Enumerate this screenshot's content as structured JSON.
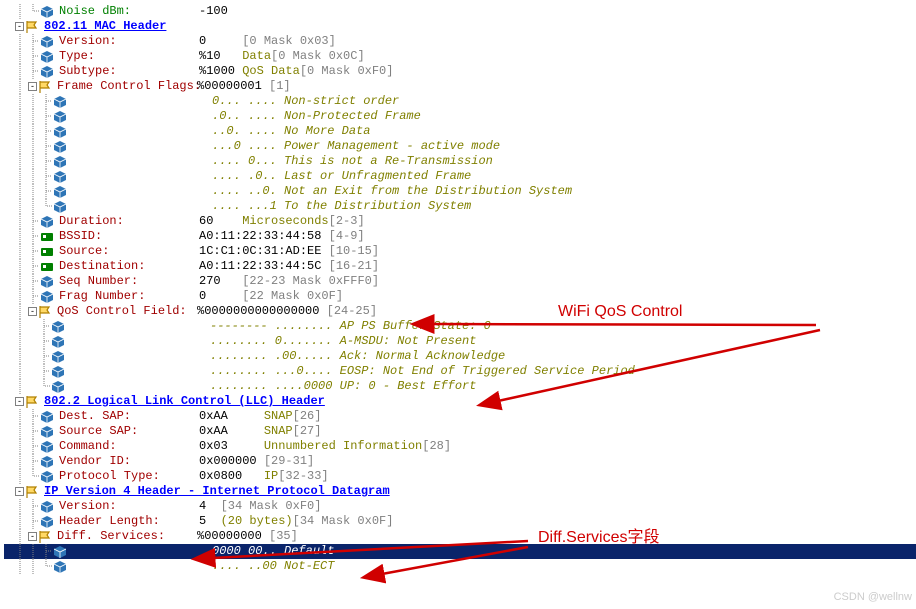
{
  "top_field": {
    "label": "Noise dBm:",
    "value": "-100"
  },
  "mac_header": {
    "title": "802.11 MAC Header",
    "fields": {
      "version": {
        "label": "Version:",
        "value": "0",
        "mask": "[0 Mask 0x03]"
      },
      "type": {
        "label": "Type:",
        "value": "%10",
        "desc": "Data",
        "mask": "[0 Mask 0x0C]"
      },
      "subtype": {
        "label": "Subtype:",
        "value": "%1000",
        "desc": "QoS Data",
        "mask": "[0 Mask 0xF0]"
      },
      "fcf": {
        "label": "Frame Control Flags:",
        "value": "%00000001",
        "mask": "[1]"
      },
      "fcf_bits": [
        {
          "bits": "0... ....",
          "desc": "Non-strict order"
        },
        {
          "bits": ".0.. ....",
          "desc": "Non-Protected Frame"
        },
        {
          "bits": "..0. ....",
          "desc": "No More Data"
        },
        {
          "bits": "...0 ....",
          "desc": "Power Management - active mode"
        },
        {
          "bits": ".... 0...",
          "desc": "This is not a Re-Transmission"
        },
        {
          "bits": ".... .0..",
          "desc": "Last or Unfragmented Frame"
        },
        {
          "bits": ".... ..0.",
          "desc": "Not an Exit from the Distribution System"
        },
        {
          "bits": ".... ...1",
          "desc": "To the Distribution System"
        }
      ],
      "duration": {
        "label": "Duration:",
        "value": "60",
        "desc": "Microseconds",
        "mask": "[2-3]"
      },
      "bssid": {
        "label": "BSSID:",
        "value": "A0:11:22:33:44:58",
        "mask": "[4-9]"
      },
      "source": {
        "label": "Source:",
        "value": "1C:C1:0C:31:AD:EE",
        "mask": "[10-15]"
      },
      "dest": {
        "label": "Destination:",
        "value": "A0:11:22:33:44:5C",
        "mask": "[16-21]"
      },
      "seq": {
        "label": "Seq Number:",
        "value": "270",
        "mask": "[22-23 Mask 0xFFF0]"
      },
      "frag": {
        "label": "Frag Number:",
        "value": "0",
        "mask": "[22 Mask 0x0F]"
      },
      "qos": {
        "label": "QoS Control Field:",
        "value": "%0000000000000000",
        "mask": "[24-25]"
      },
      "qos_bits": [
        {
          "bits": "-------- ........",
          "desc": "AP PS Buffer State: 0"
        },
        {
          "bits": "........ 0.......",
          "desc": "A-MSDU: Not Present"
        },
        {
          "bits": "........ .00.....",
          "desc": "Ack: Normal Acknowledge"
        },
        {
          "bits": "........ ...0....",
          "desc": "EOSP: Not End of Triggered Service Period"
        },
        {
          "bits": "........ ....0000",
          "desc": "UP: 0 - Best Effort"
        }
      ]
    }
  },
  "llc_header": {
    "title": "802.2 Logical Link Control (LLC) Header",
    "fields": {
      "dsap": {
        "label": "Dest. SAP:",
        "value": "0xAA",
        "desc": "SNAP",
        "mask": "[26]"
      },
      "ssap": {
        "label": "Source SAP:",
        "value": "0xAA",
        "desc": "SNAP",
        "mask": "[27]"
      },
      "cmd": {
        "label": "Command:",
        "value": "0x03",
        "desc": "Unnumbered Information",
        "mask": "[28]"
      },
      "vendor": {
        "label": "Vendor ID:",
        "value": "0x000000",
        "mask": "[29-31]"
      },
      "proto": {
        "label": "Protocol Type:",
        "value": "0x0800",
        "desc": "IP",
        "mask": "[32-33]"
      }
    }
  },
  "ip_header": {
    "title": "IP Version 4 Header - Internet Protocol Datagram",
    "fields": {
      "version": {
        "label": "Version:",
        "value": "4",
        "mask": "[34 Mask 0xF0]"
      },
      "hlen": {
        "label": "Header Length:",
        "value": "5",
        "desc": "(20 bytes)",
        "mask": "[34 Mask 0x0F]"
      },
      "diff": {
        "label": "Diff. Services:",
        "value": "%00000000",
        "mask": "[35]"
      },
      "diff_bits": [
        {
          "bits": "0000 00..",
          "desc": "Default"
        },
        {
          "bits": ".... ..00",
          "desc": "Not-ECT"
        }
      ]
    }
  },
  "annotations": {
    "qos": "WiFi QoS Control",
    "diff": "Diff.Services字段"
  },
  "watermark": "CSDN @wellnw"
}
